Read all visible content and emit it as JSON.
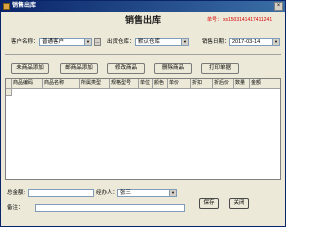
{
  "window": {
    "title": "销售出库",
    "close_glyph": "×",
    "icon": "app-icon"
  },
  "form": {
    "title": "销售出库",
    "doc_no_label": "单号：",
    "doc_no_value": "xs1503141417411241"
  },
  "fields": {
    "customer_label": "客户名称：",
    "customer_value": "普通客户",
    "customer_btn": "...",
    "warehouse_label": "出货仓库：",
    "warehouse_value": "默认仓库",
    "date_label": "销售日期：",
    "date_value": "2017-03-14"
  },
  "toolbar": {
    "buttons": [
      "未商品添加",
      "邮商品添加",
      "修改商品",
      "删除商品",
      "打印单据"
    ]
  },
  "grid": {
    "columns": [
      "商品编码",
      "商品名称",
      "所属类型",
      "规格型号",
      "单位",
      "颜色",
      "单价",
      "折扣",
      "折后价",
      "数量",
      "金额"
    ]
  },
  "footer": {
    "total_label": "总金额:",
    "handler_label": "经办人：",
    "handler_value": "张三",
    "remark_label": "备注：",
    "save_label": "保存",
    "close_label": "关闭"
  }
}
